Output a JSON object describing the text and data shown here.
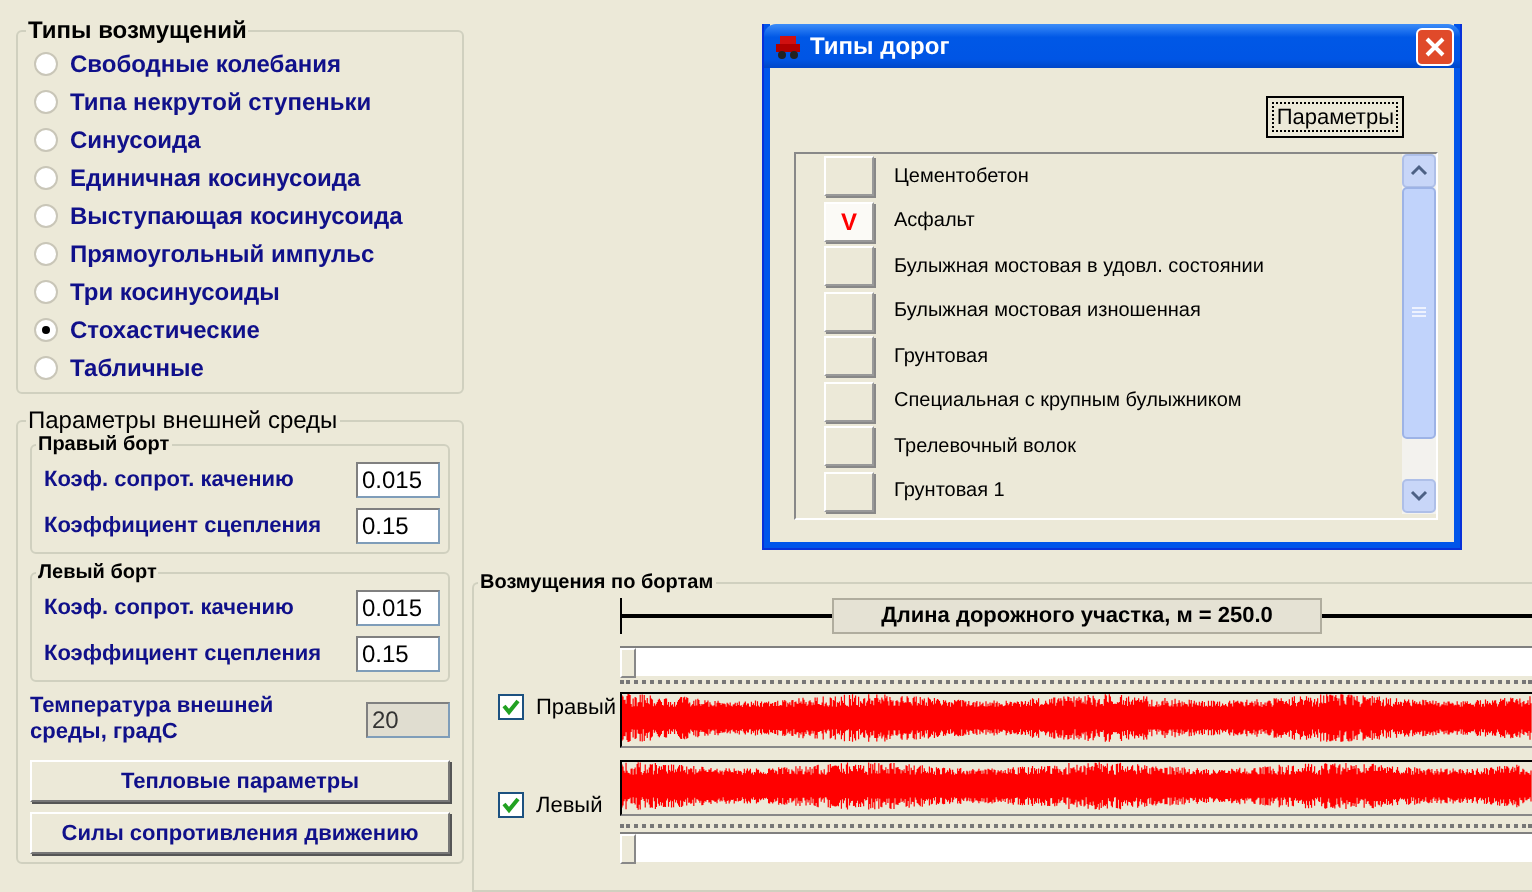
{
  "disturbance_types": {
    "title": "Типы возмущений",
    "options": [
      {
        "label": "Свободные колебания",
        "selected": false
      },
      {
        "label": "Типа некрутой ступеньки",
        "selected": false
      },
      {
        "label": "Синусоида",
        "selected": false
      },
      {
        "label": "Единичная косинусоида",
        "selected": false
      },
      {
        "label": "Выступающая косинусоида",
        "selected": false
      },
      {
        "label": "Прямоугольный импульс",
        "selected": false
      },
      {
        "label": "Три косинусоиды",
        "selected": false
      },
      {
        "label": "Стохастические",
        "selected": true
      },
      {
        "label": "Табличные",
        "selected": false
      }
    ]
  },
  "environment": {
    "title": "Параметры внешней среды",
    "sides": [
      {
        "title": "Правый борт",
        "fields": [
          {
            "label": "Коэф. сопрот. качению",
            "value": "0.015"
          },
          {
            "label": "Коэффициент сцепления",
            "value": "0.15"
          }
        ]
      },
      {
        "title": "Левый борт",
        "fields": [
          {
            "label": "Коэф. сопрот. качению",
            "value": "0.015"
          },
          {
            "label": "Коэффициент сцепления",
            "value": "0.15"
          }
        ]
      }
    ],
    "temperature": {
      "label": "Температура внешней среды, градС",
      "value": "20",
      "disabled": true
    },
    "buttons": [
      "Тепловые параметры",
      "Силы сопротивления движению"
    ]
  },
  "road_dialog": {
    "title": "Типы дорог",
    "button": "Параметры",
    "check_mark": "V",
    "roads": [
      {
        "label": "Цементобетон",
        "checked": false
      },
      {
        "label": "Асфальт",
        "checked": true
      },
      {
        "label": "Булыжная мостовая в удовл. состоянии",
        "checked": false
      },
      {
        "label": "Булыжная мостовая изношенная",
        "checked": false
      },
      {
        "label": "Грунтовая",
        "checked": false
      },
      {
        "label": "Специальная с крупным булыжником",
        "checked": false
      },
      {
        "label": "Трелевочный волок",
        "checked": false
      },
      {
        "label": "Грунтовая 1",
        "checked": false
      }
    ]
  },
  "side_disturbances": {
    "title": "Возмущения по бортам",
    "length_label": "Длина дорожного участка, м = 250.0",
    "top_slider": {
      "level": 0
    },
    "sides": [
      {
        "label": "Правый",
        "checked": true
      },
      {
        "label": "Левый",
        "checked": true
      }
    ],
    "bottom_slider": {
      "level": 0
    }
  }
}
